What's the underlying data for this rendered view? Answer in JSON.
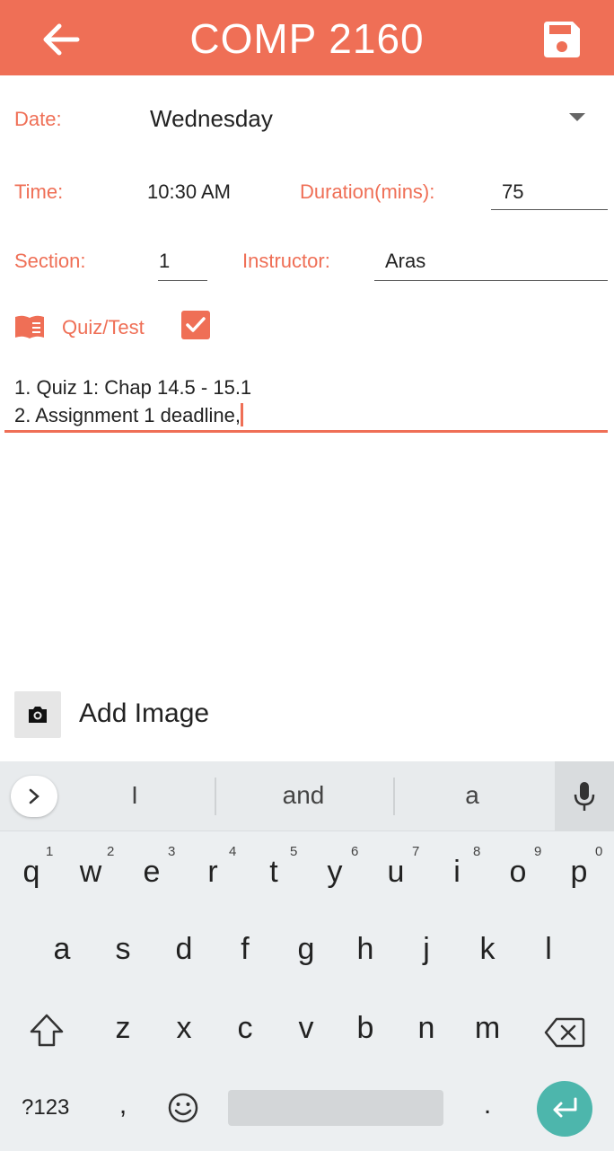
{
  "app_bar": {
    "title": "COMP 2160"
  },
  "form": {
    "date_label": "Date:",
    "date_value": "Wednesday",
    "time_label": "Time:",
    "time_value": "10:30 AM",
    "duration_label": "Duration(mins):",
    "duration_value": "75",
    "section_label": "Section:",
    "section_value": "1",
    "instructor_label": "Instructor:",
    "instructor_value": "Aras",
    "quiz_label": "Quiz/Test",
    "quiz_checked": true,
    "notes": "1. Quiz 1: Chap 14.5 - 15.1\n2. Assignment 1 deadline,"
  },
  "add_image": {
    "label": "Add Image"
  },
  "keyboard": {
    "suggestions": [
      "I",
      "and",
      "a"
    ],
    "row1": [
      "q",
      "w",
      "e",
      "r",
      "t",
      "y",
      "u",
      "i",
      "o",
      "p"
    ],
    "row1_hints": [
      "1",
      "2",
      "3",
      "4",
      "5",
      "6",
      "7",
      "8",
      "9",
      "0"
    ],
    "row2": [
      "a",
      "s",
      "d",
      "f",
      "g",
      "h",
      "j",
      "k",
      "l"
    ],
    "row3": [
      "z",
      "x",
      "c",
      "v",
      "b",
      "n",
      "m"
    ],
    "symbols_key": "?123",
    "comma_key": ",",
    "period_key": "."
  },
  "colors": {
    "accent": "#EF6F56",
    "enter": "#4DB6AC"
  }
}
